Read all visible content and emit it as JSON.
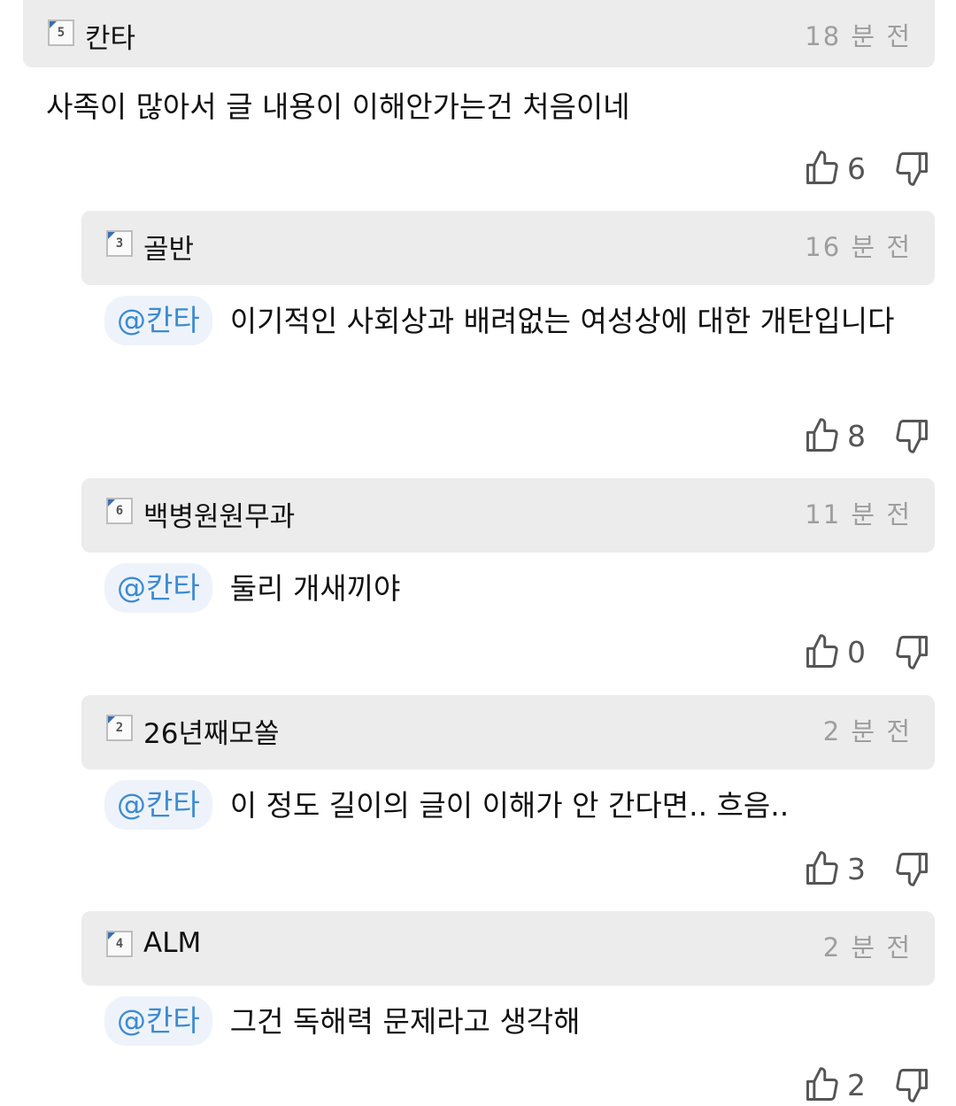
{
  "comments": [
    {
      "level": "5",
      "username": "칸타",
      "time": "18 분 전",
      "mention": "",
      "text": "사족이 많아서 글 내용이 이해안가는건 처음이네",
      "likes": "6"
    },
    {
      "level": "3",
      "username": "골반",
      "time": "16 분 전",
      "mention": "@칸타",
      "text": "이기적인 사회상과 배려없는 여성상에 대한 개탄입니다",
      "likes": "8"
    },
    {
      "level": "6",
      "username": "백병원원무과",
      "time": "11 분 전",
      "mention": "@칸타",
      "text": "둘리 개새끼야",
      "likes": "0"
    },
    {
      "level": "2",
      "username": "26년째모쏠",
      "time": "2 분 전",
      "mention": "@칸타",
      "text": "이 정도 길이의 글이 이해가 안 간다면.. 흐음..",
      "likes": "3"
    },
    {
      "level": "4",
      "username": "ALM",
      "time": "2 분 전",
      "mention": "@칸타",
      "text": "그건 독해력 문제라고 생각해",
      "likes": "2"
    }
  ],
  "icons": {
    "like": "thumbs-up-icon",
    "dislike": "thumbs-down-icon"
  },
  "colors": {
    "header_bg": "#ececec",
    "mention_text": "#3b8bd1",
    "time_text": "#9e9e9e"
  }
}
